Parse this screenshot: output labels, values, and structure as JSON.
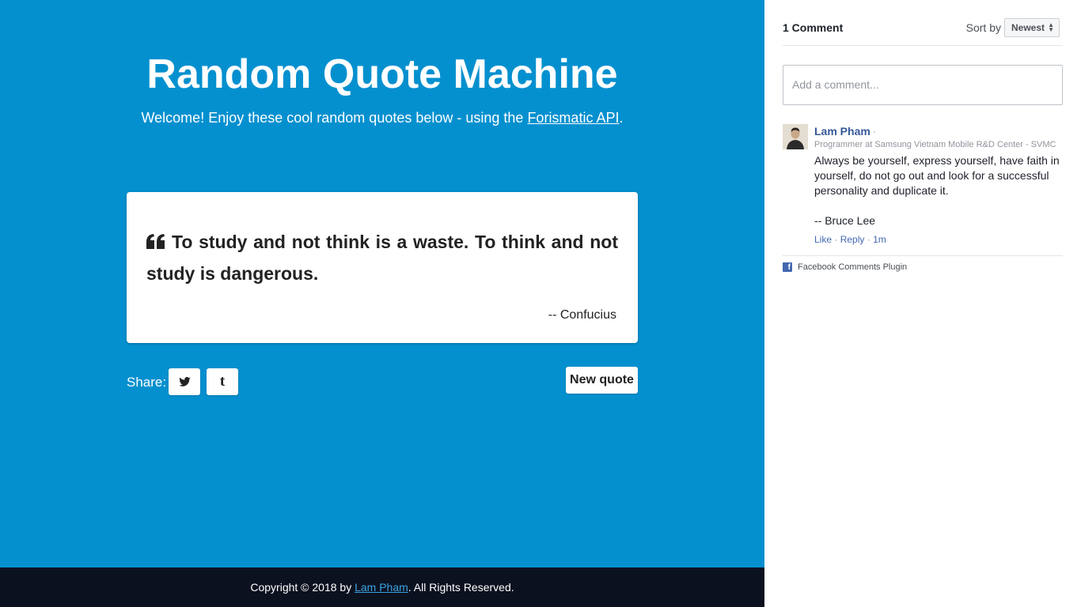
{
  "main": {
    "title": "Random Quote Machine",
    "subtitle_prefix": "Welcome! Enjoy these cool random quotes below - using the ",
    "subtitle_link": "Forismatic API",
    "subtitle_suffix": ".",
    "background_color": "#0490cf"
  },
  "quote": {
    "text": "To study and not think is a waste. To think and not study is dangerous.",
    "author": "-- Confucius"
  },
  "share": {
    "label": "Share:",
    "twitter_icon": "twitter-icon",
    "tumblr_icon": "tumblr-icon",
    "tumblr_glyph": "t"
  },
  "new_quote_label": "New quote",
  "footer": {
    "prefix": "Copyright © 2018 by ",
    "link": "Lam Pham",
    "suffix": ". All Rights Reserved.",
    "background_color": "#0c1120"
  },
  "comments": {
    "count_label": "1 Comment",
    "sort_label": "Sort by",
    "sort_value": "Newest",
    "input_placeholder": "Add a comment...",
    "items": [
      {
        "name": "Lam Pham",
        "dot": "·",
        "role": "Programmer at Samsung Vietnam Mobile R&D Center - SVMC",
        "body": "Always be yourself, express yourself, have faith in yourself, do not go out and look for a successful personality and duplicate it.",
        "signature": "-- Bruce Lee",
        "like": "Like",
        "reply": "Reply",
        "time": "1m"
      }
    ],
    "plugin_label": "Facebook Comments Plugin",
    "link_color": "#365899"
  }
}
